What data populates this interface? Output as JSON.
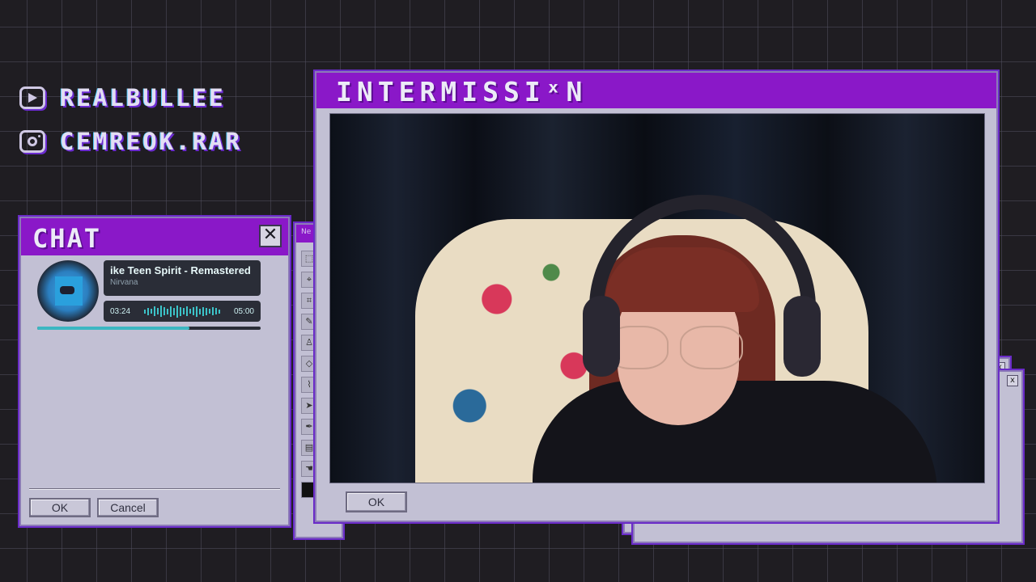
{
  "socials": [
    {
      "icon": "youtube-icon",
      "handle": "REALBULLEE"
    },
    {
      "icon": "instagram-icon",
      "handle": "CEMREOK.RAR"
    }
  ],
  "colors": {
    "accent": "#8a18c8",
    "window_bg": "#c2c0d4",
    "teal": "#3bb7c2"
  },
  "chat": {
    "title": "CHAT",
    "close_glyph": "✕",
    "ok_label": "OK",
    "cancel_label": "Cancel",
    "now_playing": {
      "title": "ike Teen Spirit - Remastered",
      "artist": "Nirvana",
      "elapsed": "03:24",
      "duration": "05:00",
      "progress": 0.68
    }
  },
  "toolbar": {
    "title": "Ne"
  },
  "main": {
    "title": "INTERMISSIˣN",
    "ok_label": "OK"
  },
  "stack": {
    "close_glyph": "x"
  }
}
